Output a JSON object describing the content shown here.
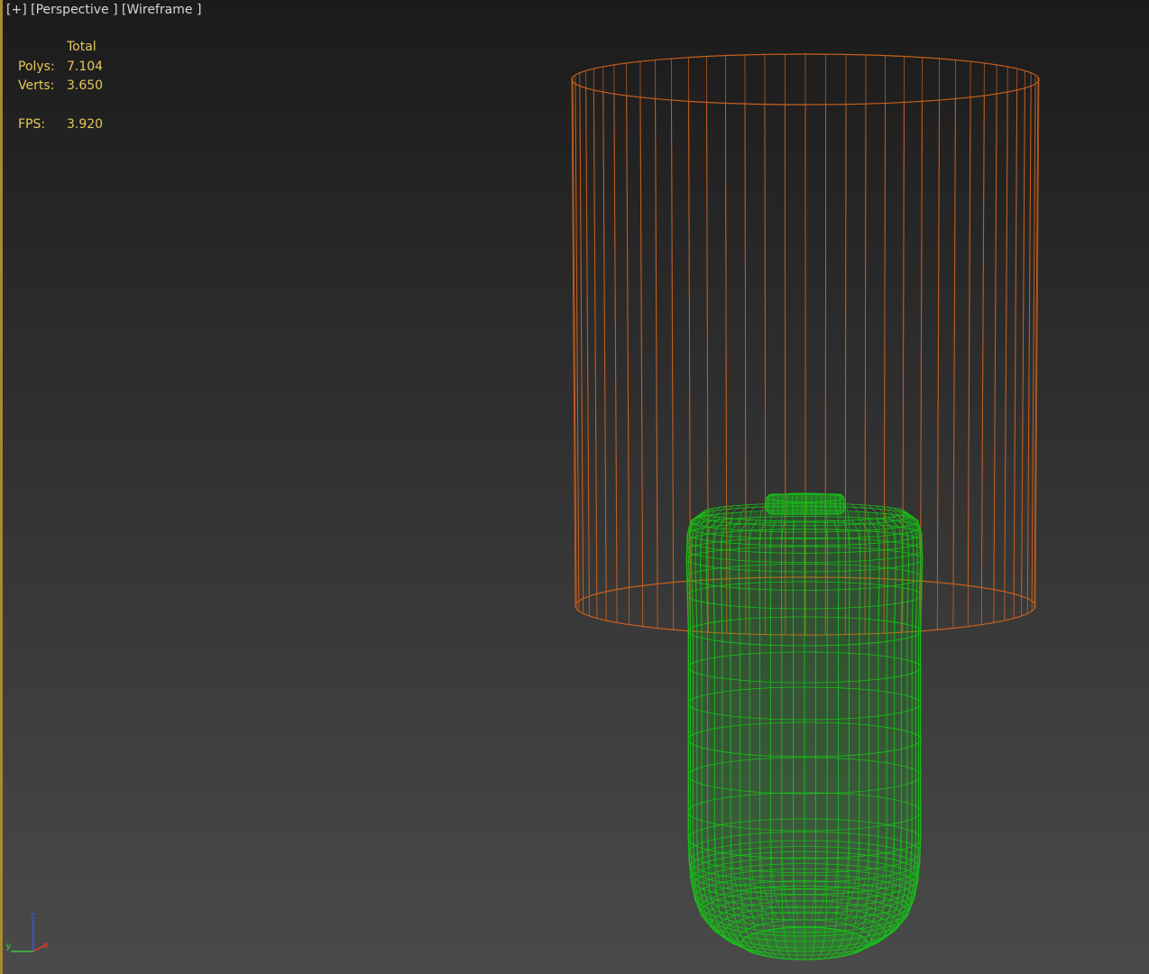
{
  "viewport": {
    "label_parts": [
      "[+]",
      "[Perspective ]",
      "[Wireframe ]"
    ],
    "background_top": "#1b1b1b",
    "background_bottom": "#4a4a4a",
    "active_border_color": "#a98a2c",
    "view": "Perspective",
    "shading": "Wireframe"
  },
  "stats": {
    "header": "Total",
    "rows": [
      {
        "label": "Polys:",
        "value": "7.104"
      },
      {
        "label": "Verts:",
        "value": "3.650"
      }
    ],
    "fps_label": "FPS:",
    "fps_value": "3.920",
    "color": "#e6c85b"
  },
  "scene": {
    "objects": [
      {
        "name": "lamp-shade",
        "wire_color": "#c8601c"
      },
      {
        "name": "lamp-base",
        "wire_color": "#18c018"
      }
    ]
  },
  "axis_gizmo": {
    "labels": [
      "z",
      "x",
      "y"
    ],
    "z_color": "#3a56e8",
    "x_color": "#e03a2a",
    "y_color": "#3fbf3f"
  }
}
